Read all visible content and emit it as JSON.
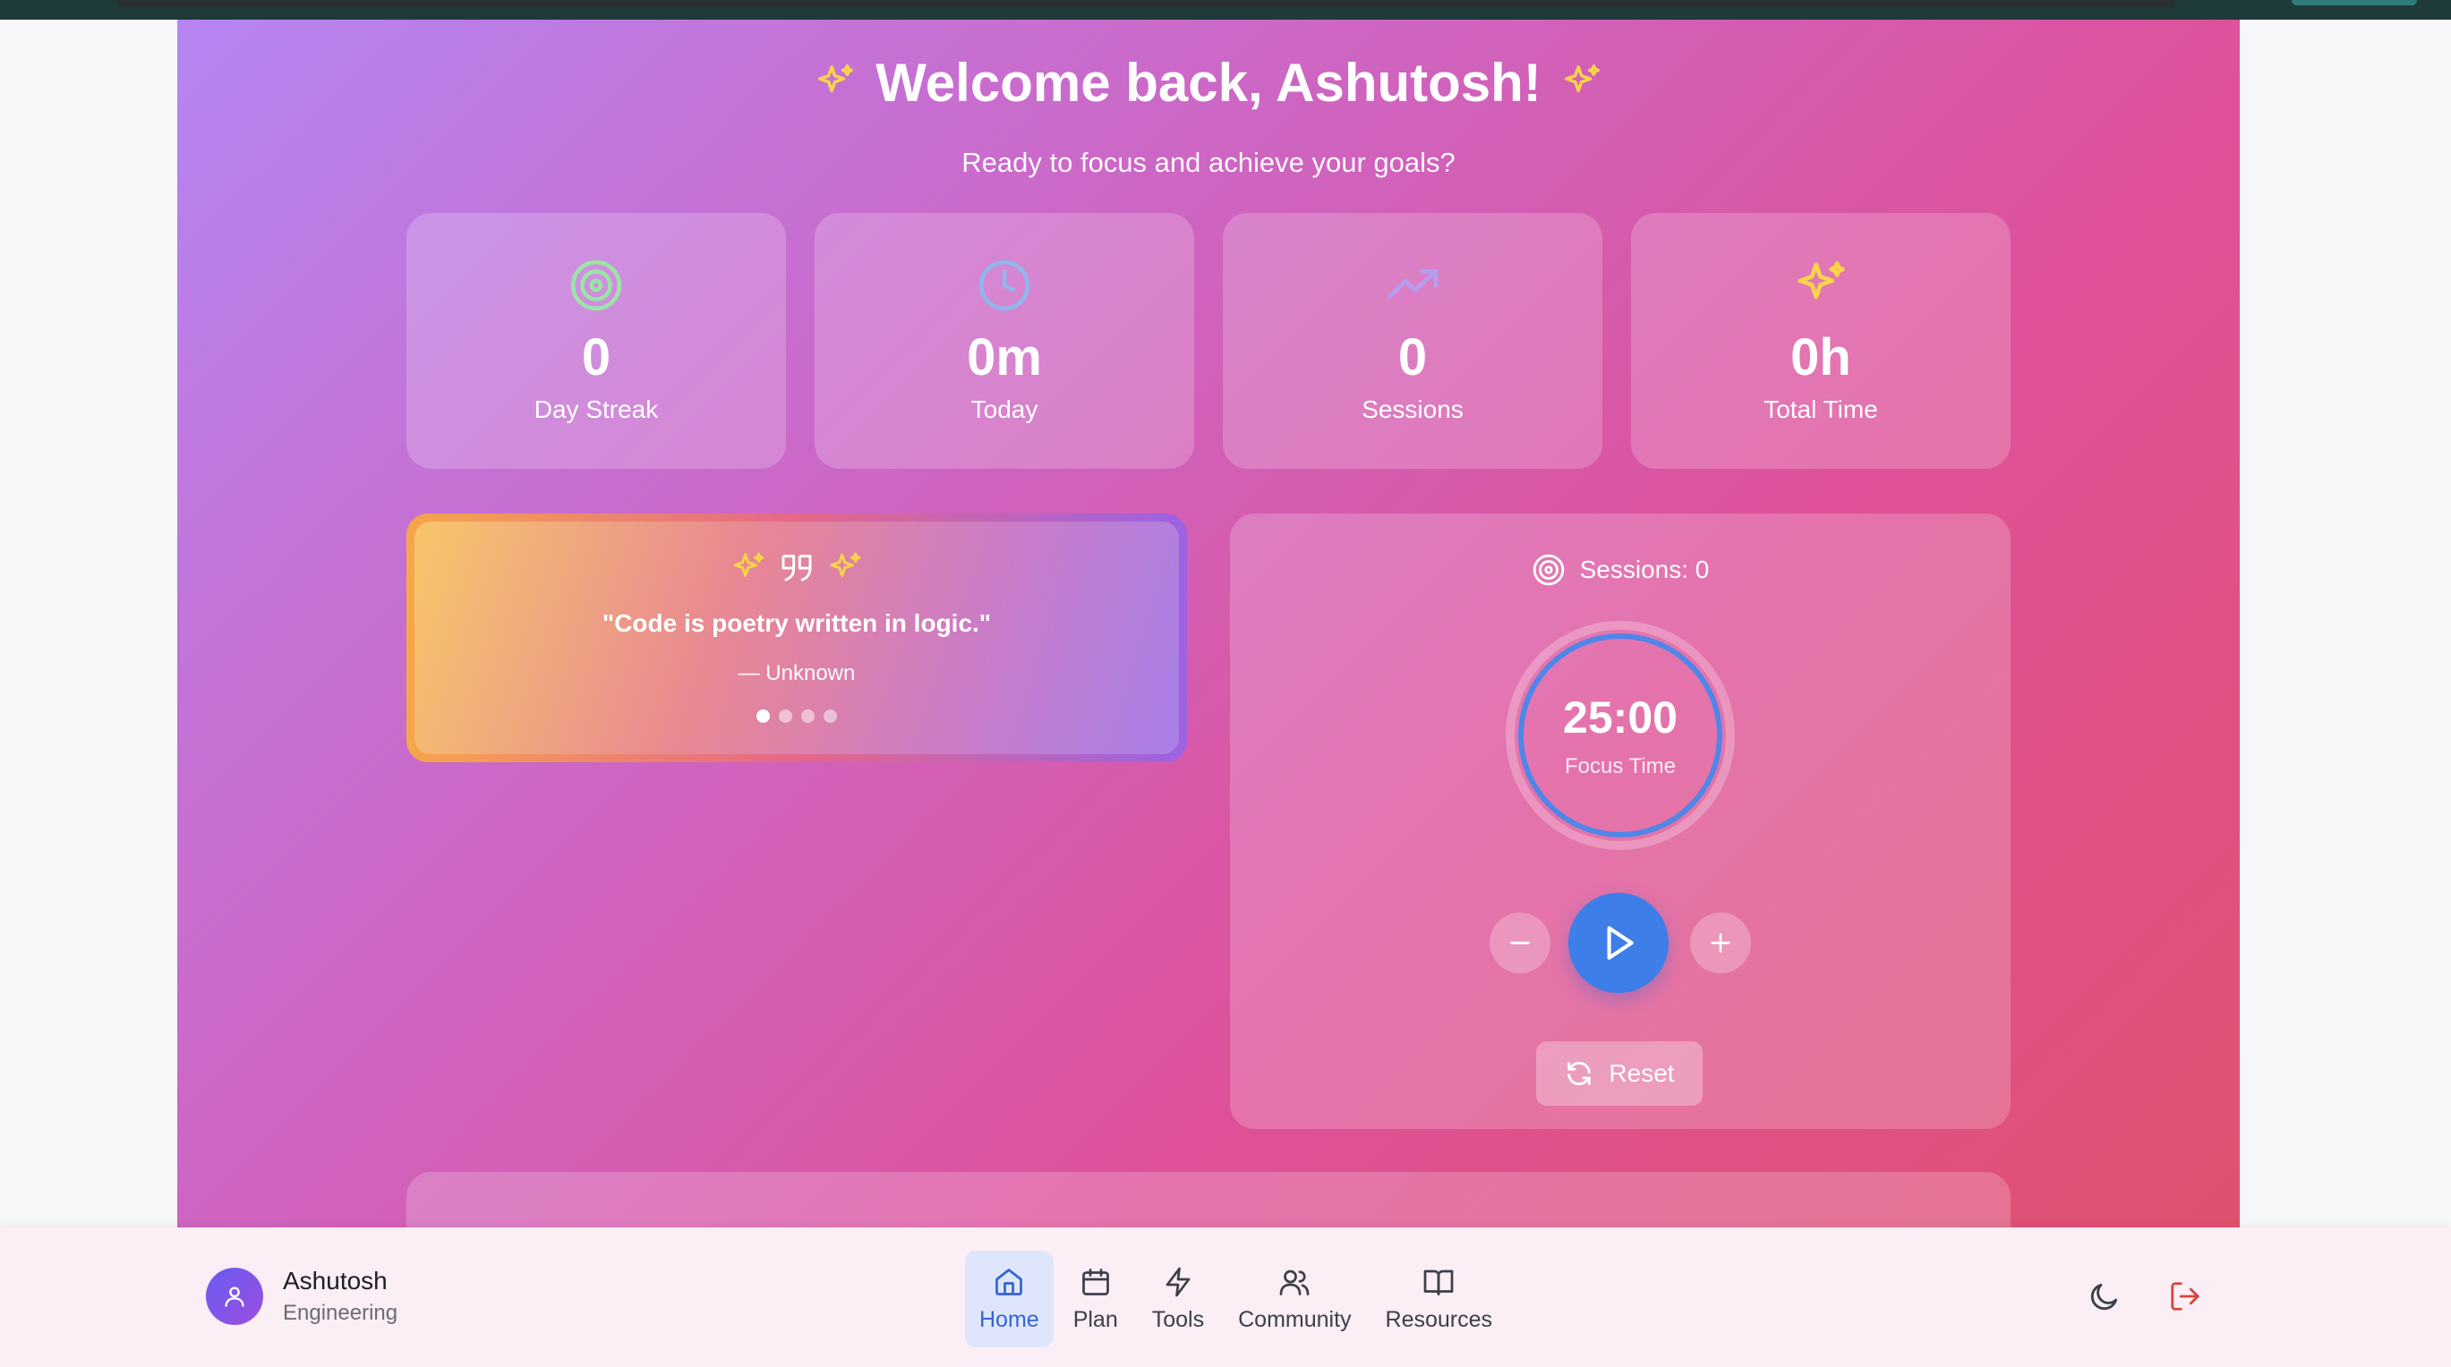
{
  "header": {
    "title": "Welcome back, Ashutosh!",
    "subtitle": "Ready to focus and achieve your goals?"
  },
  "stats": [
    {
      "value": "0",
      "label": "Day Streak",
      "icon": "target-icon",
      "color": "#9be3a7"
    },
    {
      "value": "0m",
      "label": "Today",
      "icon": "clock-icon",
      "color": "#8fb7ee"
    },
    {
      "value": "0",
      "label": "Sessions",
      "icon": "trending-up-icon",
      "color": "#b49ef0"
    },
    {
      "value": "0h",
      "label": "Total Time",
      "icon": "sparkles-icon",
      "color": "#f8d548"
    }
  ],
  "quote": {
    "text": "\"Code is poetry written in logic.\"",
    "author": "— Unknown",
    "active_index": 0,
    "total": 4
  },
  "timer": {
    "sessions_label": "Sessions: 0",
    "time": "25:00",
    "mode_label": "Focus Time",
    "reset_label": "Reset",
    "accent": "#3d7ee8"
  },
  "nav": {
    "user_name": "Ashutosh",
    "user_dept": "Engineering",
    "items": [
      {
        "label": "Home",
        "icon": "home-icon",
        "active": true
      },
      {
        "label": "Plan",
        "icon": "calendar-icon",
        "active": false
      },
      {
        "label": "Tools",
        "icon": "lightning-icon",
        "active": false
      },
      {
        "label": "Community",
        "icon": "users-icon",
        "active": false
      },
      {
        "label": "Resources",
        "icon": "book-icon",
        "active": false
      }
    ],
    "active_color": "#3563d6",
    "logout_color": "#d8453c"
  }
}
